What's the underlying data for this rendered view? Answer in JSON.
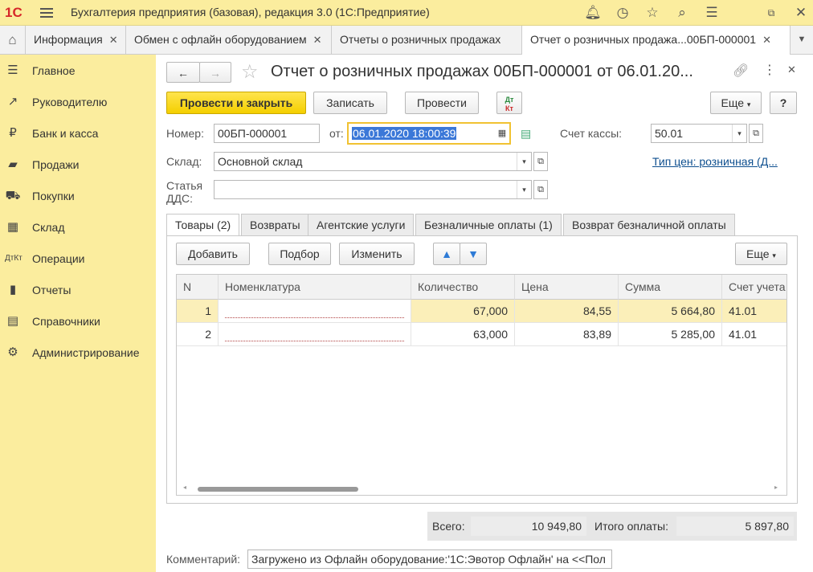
{
  "app": {
    "logo": "1С",
    "title": "Бухгалтерия предприятия (базовая), редакция 3.0  (1С:Предприятие)",
    "toolbar_icons": [
      "bell-icon",
      "history-icon",
      "star-icon",
      "search-icon",
      "list-icon",
      "restore-window-icon",
      "close-icon"
    ]
  },
  "tabs": [
    {
      "label": "Информация",
      "close": "✕"
    },
    {
      "label": "Обмен с офлайн оборудованием",
      "close": "✕"
    },
    {
      "label": "Отчеты о розничных продажах",
      "close": ""
    },
    {
      "label": "Отчет о розничных продажа...00БП-000001",
      "close": "✕"
    }
  ],
  "sidebar": {
    "items": [
      {
        "label": "Главное"
      },
      {
        "label": "Руководителю"
      },
      {
        "label": "Банк и касса"
      },
      {
        "label": "Продажи"
      },
      {
        "label": "Покупки"
      },
      {
        "label": "Склад"
      },
      {
        "label": "Операции"
      },
      {
        "label": "Отчеты"
      },
      {
        "label": "Справочники"
      },
      {
        "label": "Администрирование"
      }
    ]
  },
  "form": {
    "title": "Отчет о розничных продажах 00БП-000001 от 06.01.20...",
    "buttons": {
      "post_close": "Провести и закрыть",
      "save": "Записать",
      "post": "Провести",
      "dtkt_top": "Дт",
      "dtkt_bottom": "Кт",
      "more": "Еще",
      "help": "?"
    },
    "number_label": "Номер:",
    "number_value": "00БП-000001",
    "date_label": "от:",
    "date_value": "06.01.2020 18:00:39",
    "cash_account_label": "Счет кассы:",
    "cash_account_value": "50.01",
    "warehouse_label": "Склад:",
    "warehouse_value": "Основной склад",
    "price_type_link": "Тип цен: розничная (Д...",
    "dds_label_1": "Статья",
    "dds_label_2": "ДДС:",
    "dds_value": ""
  },
  "form_tabs": [
    {
      "label": "Товары (2)"
    },
    {
      "label": "Возвраты"
    },
    {
      "label": "Агентские услуги"
    },
    {
      "label": "Безналичные оплаты (1)"
    },
    {
      "label": "Возврат безналичной оплаты"
    }
  ],
  "table_toolbar": {
    "add": "Добавить",
    "pick": "Подбор",
    "edit": "Изменить",
    "more": "Еще"
  },
  "table": {
    "columns": [
      "N",
      "Номенклатура",
      "Количество",
      "Цена",
      "Сумма",
      "Счет учета"
    ],
    "rows": [
      {
        "n": "1",
        "item": "",
        "qty": "67,000",
        "price": "84,55",
        "sum": "5 664,80",
        "account": "41.01"
      },
      {
        "n": "2",
        "item": "",
        "qty": "63,000",
        "price": "83,89",
        "sum": "5 285,00",
        "account": "41.01"
      }
    ]
  },
  "totals": {
    "total_label": "Всего:",
    "total_value": "10 949,80",
    "payment_label": "Итого оплаты:",
    "payment_value": "5 897,80"
  },
  "comment": {
    "label": "Комментарий:",
    "value": "Загружено из Офлайн оборудование:'1С:Эвотор Офлайн' на <<Пол"
  }
}
